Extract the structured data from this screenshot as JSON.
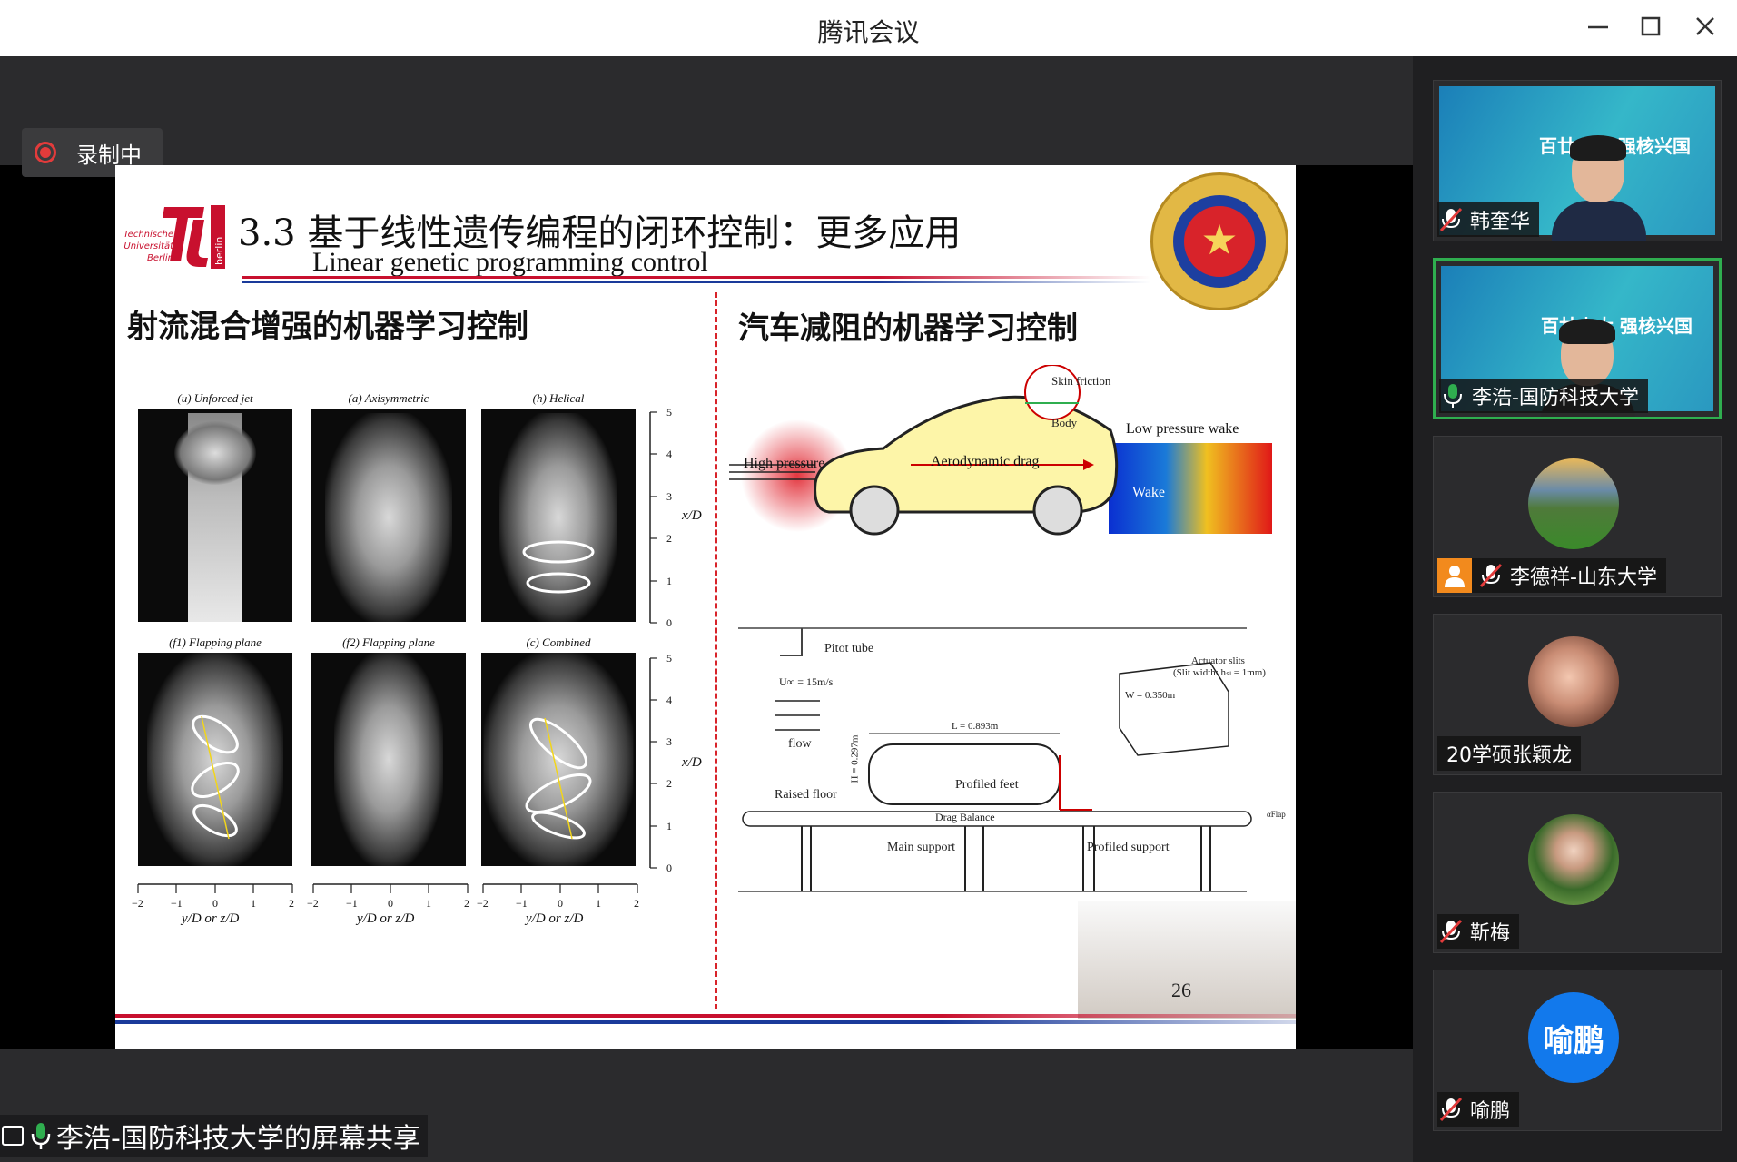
{
  "window": {
    "title": "腾讯会议",
    "minimize_icon": "minimize-icon",
    "maximize_icon": "maximize-icon",
    "close_icon": "close-icon"
  },
  "recording": {
    "label": "录制中",
    "color": "#e23b3b"
  },
  "slide": {
    "title": "3.3 基于线性遗传编程的闭环控制：更多应用",
    "subtitle": "Linear genetic programming control",
    "tu_logo_text": [
      "Technische",
      "Universität",
      "Berlin"
    ],
    "tu_logo_vertical": "berlin",
    "left_heading": "射流混合增强的机器学习控制",
    "right_heading": "汽车减阻的机器学习控制",
    "jet_panels": [
      {
        "title": "(u) Unforced jet"
      },
      {
        "title": "(a) Axisymmetric"
      },
      {
        "title": "(h) Helical"
      },
      {
        "title": "(f1) Flapping plane"
      },
      {
        "title": "(f2) Flapping plane"
      },
      {
        "title": "(c) Combined"
      }
    ],
    "xD_label": "x/D",
    "yD_label": "y/D or z/D",
    "y_ticks": [
      "5",
      "4",
      "3",
      "2",
      "1",
      "0"
    ],
    "x_ticks": [
      "−2",
      "−1",
      "0",
      "1",
      "2"
    ],
    "car": {
      "high_pressure": "High pressure",
      "aero_drag": "Aerodynamic drag",
      "skin_friction": "Skin friction",
      "body": "Body",
      "low_pressure_wake": "Low pressure wake",
      "wake": "Wake"
    },
    "tunnel": {
      "pitot": "Pitot tube",
      "velocity": "U∞ = 15m/s",
      "flow": "flow",
      "L": "L = 0.893m",
      "H": "H = 0.297m",
      "W": "W = 0.350m",
      "actuator": "Actuator slits",
      "slit": "(Slit width: hₛₗ = 1mm)",
      "raised_floor": "Raised floor",
      "profiled_feet": "Profiled feet",
      "drag_balance": "Drag Balance",
      "main_support": "Main support",
      "profiled_support": "Profiled support",
      "flap": "αFlap"
    },
    "page_number": "26"
  },
  "sharer": {
    "label": "李浩-国防科技大学的屏幕共享"
  },
  "participants": [
    {
      "name": "韩奎华",
      "muted": true,
      "kind": "video",
      "banner": "百廿山大 强核兴国"
    },
    {
      "name": "李浩-国防科技大学",
      "muted": false,
      "kind": "video",
      "active": true,
      "banner": "百廿山大 强核兴国"
    },
    {
      "name": "李德祥-山东大学",
      "muted": true,
      "kind": "avatar-landscape",
      "host": true
    },
    {
      "name": "20学硕张颖龙",
      "muted": null,
      "kind": "avatar-photo"
    },
    {
      "name": "靳梅",
      "muted": true,
      "kind": "avatar-woman"
    },
    {
      "name": "喻鹏",
      "muted": true,
      "kind": "avatar-text",
      "avatar_text": "喻鹏"
    }
  ],
  "colors": {
    "accent_green": "#2fae4f",
    "avatar_blue": "#1279ec",
    "host_orange": "#f28a1d",
    "tu_red": "#c8102e"
  }
}
